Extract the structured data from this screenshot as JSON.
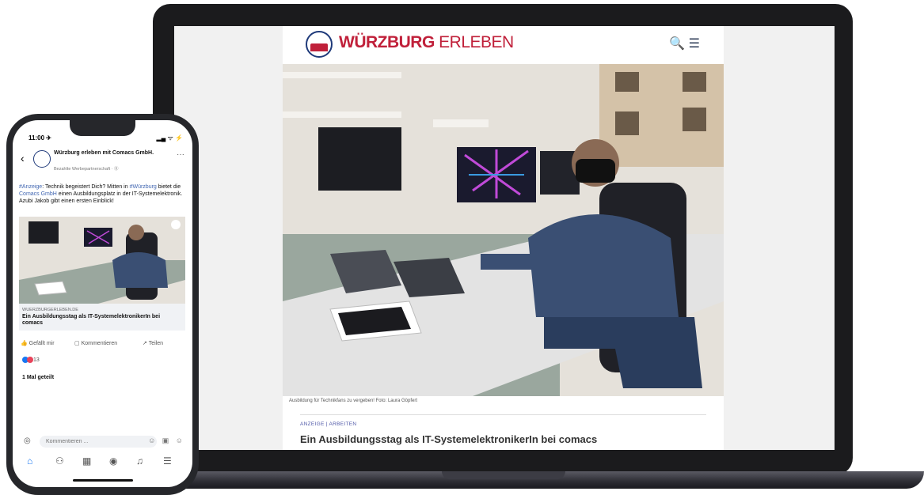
{
  "laptop": {
    "site_logo_bold": "WÜRZBURG",
    "site_logo_light": "ERLEBEN",
    "header_icons": "🔍 ☰",
    "photo_caption": "Ausbildung für Technikfans zu vergeben! Foto: Laura Göpfert",
    "category": "ANZEIGE | ARBEITEN",
    "article_title": "Ein Ausbildungsstag als IT-SystemelektronikerIn bei comacs"
  },
  "phone": {
    "status_time": "11:00 ✈",
    "status_icons": "▂▄ ᯤ ⚡",
    "page_name": "Würzburg erleben mit Comacs GmbH.",
    "sponsored": "Bezahlte Werbepartnerschaft · ⓖ",
    "post_text_1": "#Anzeige",
    "post_text_2": ": Technik begeistert Dich? Mitten in ",
    "post_text_3": "#Würzburg",
    "post_text_4": " bietet die ",
    "post_text_5": "Comacs GmbH",
    "post_text_6": " einen Ausbildungsplatz in der IT-Systemelektronik. Azubi Jakob gibt einen ersten Einblick!",
    "link_domain": "WUERZBURGERLEBEN.DE",
    "link_title": "Ein Ausbildungsstag als IT-SystemelektronikerIn bei comacs",
    "like_label": "Gefällt mir",
    "comment_label": "Kommentieren",
    "share_label": "Teilen",
    "reaction_count": "13",
    "shares": "1 Mal geteilt",
    "comment_placeholder": "Kommentieren ...",
    "colors": {
      "brand_red": "#c0203a",
      "brand_blue": "#1f3a7a",
      "fb_blue": "#1877f2",
      "like_blue": "#1877f2",
      "love_red": "#e8435a"
    }
  }
}
